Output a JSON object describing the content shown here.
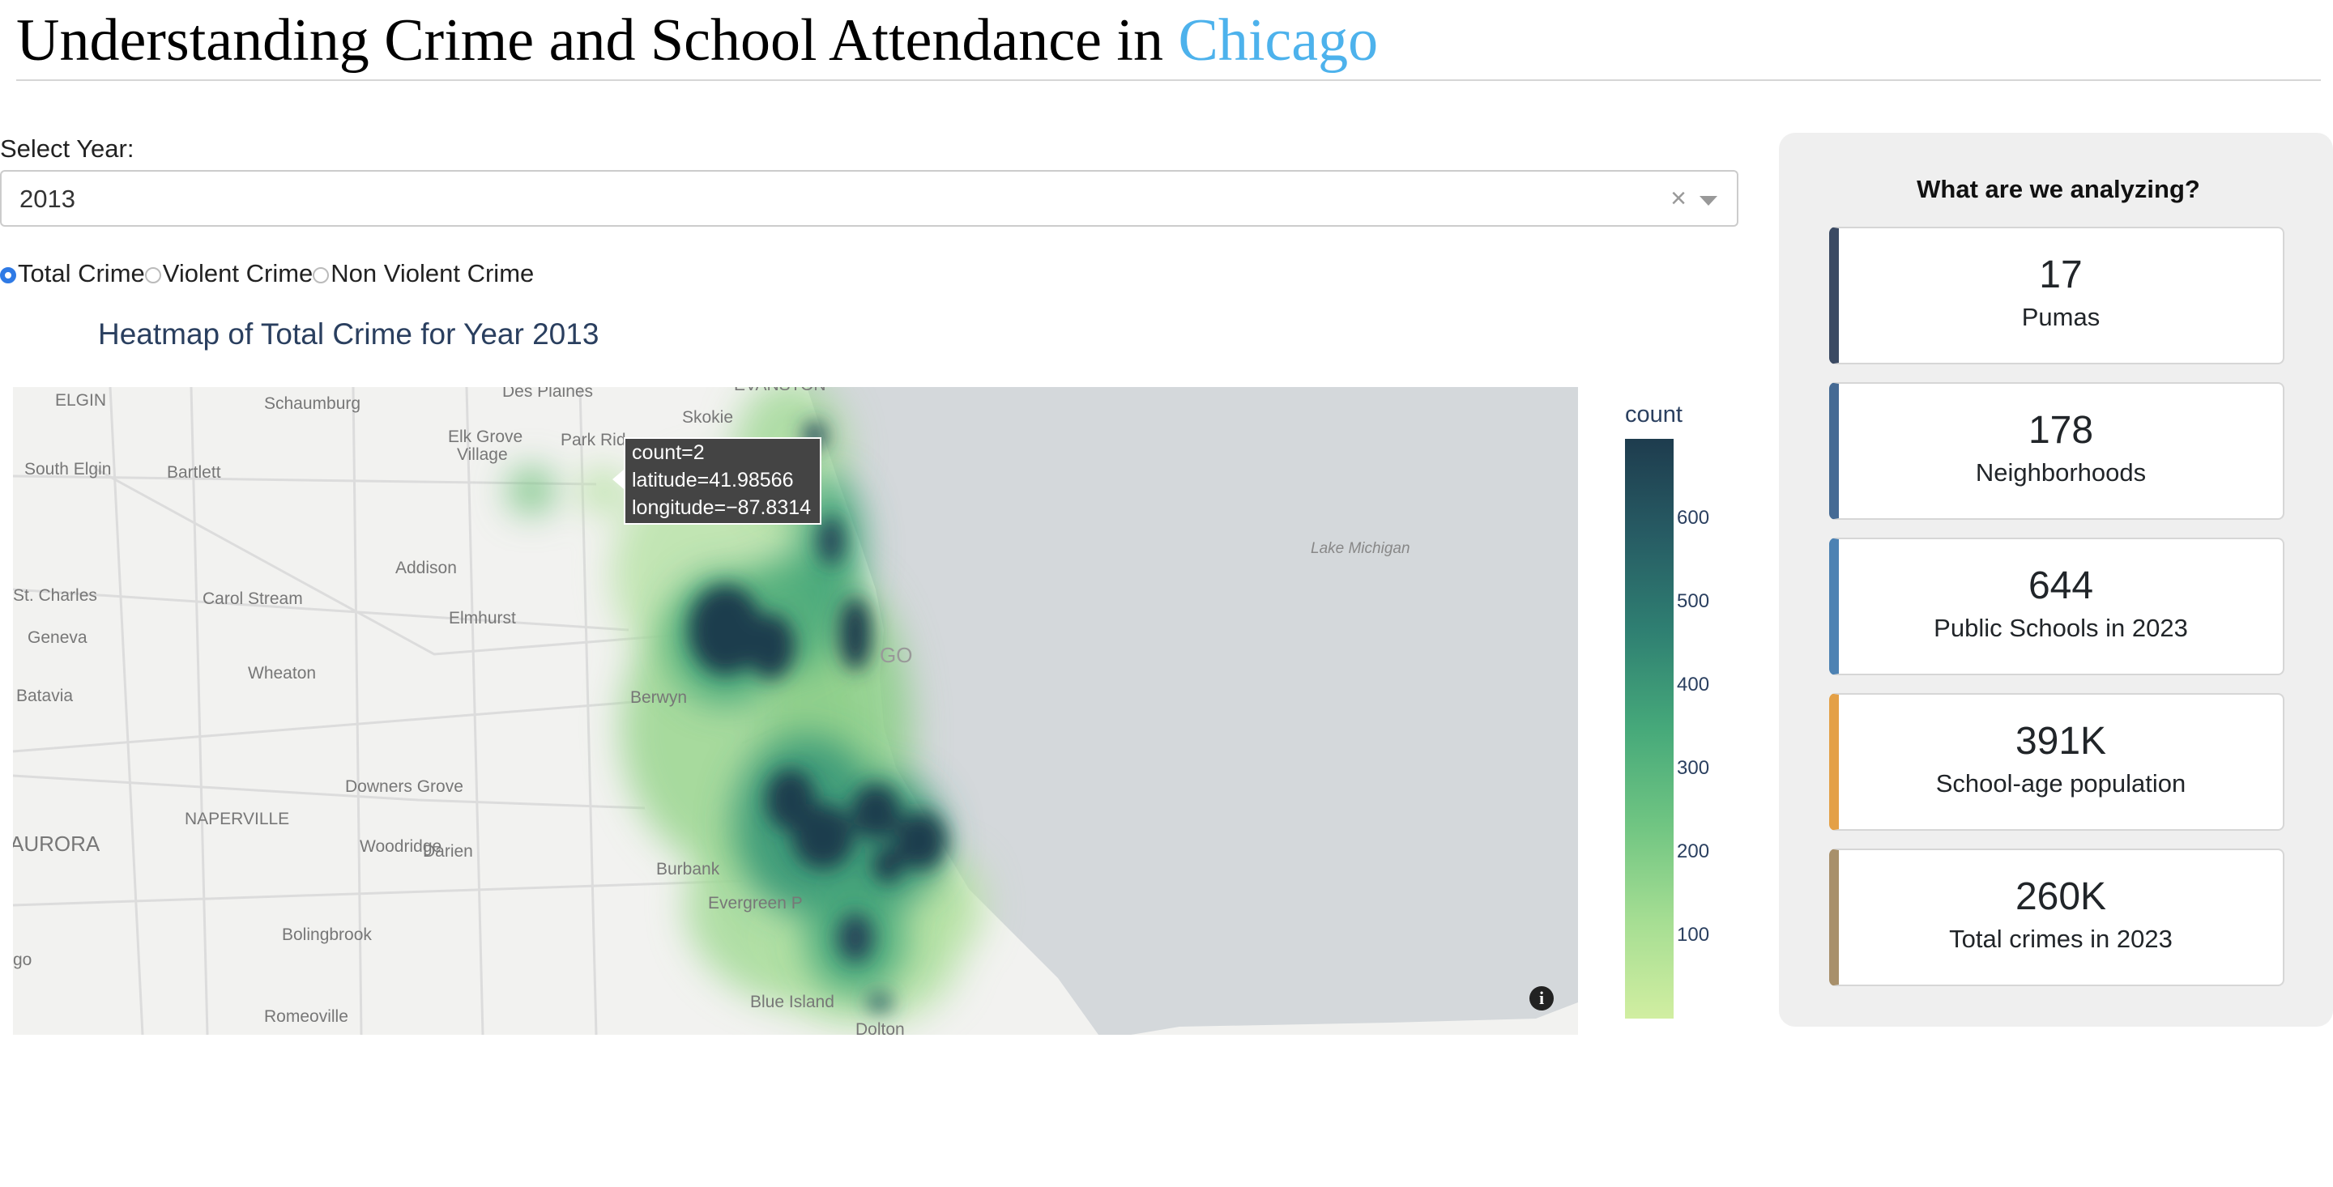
{
  "header": {
    "title_prefix": "Understanding Crime and School Attendance in ",
    "title_accent": "Chicago"
  },
  "year_select": {
    "label": "Select Year:",
    "value": "2013",
    "clear_symbol": "×"
  },
  "crime_type": {
    "options": [
      {
        "label": "Total Crime",
        "selected": true
      },
      {
        "label": "Violent Crime",
        "selected": false
      },
      {
        "label": "Non Violent Crime",
        "selected": false
      }
    ]
  },
  "chart": {
    "title": "Heatmap of Total Crime for Year 2013",
    "colorbar_title": "count",
    "colorbar_ticks": [
      "600",
      "500",
      "400",
      "300",
      "200",
      "100"
    ],
    "tooltip": {
      "count": "count=2",
      "latitude": "latitude=41.98566",
      "longitude": "longitude=−87.8314"
    },
    "info_symbol": "i",
    "map_labels": [
      "ELGIN",
      "Schaumburg",
      "Des Plaines",
      "Skokie",
      "EVANSTON",
      "Elk Grove Village",
      "Park Rid",
      "South Elgin",
      "Bartlett",
      "Addison",
      "St. Charles",
      "Carol Stream",
      "Elmhurst",
      "Geneva",
      "Wheaton",
      "Berwyn",
      "Batavia",
      "Downers Grove",
      "NAPERVILLE",
      "AURORA",
      "Woodridge",
      "Darien",
      "Burbank",
      "Evergreen P",
      "Bolingbrook",
      "Romeoville",
      "Blue Island",
      "Dolton",
      "Lake Michigan",
      "GO",
      "go"
    ]
  },
  "chart_data": {
    "type": "heatmap",
    "title": "Heatmap of Total Crime for Year 2013",
    "colorbar": {
      "title": "count",
      "range": [
        0,
        700
      ],
      "ticks": [
        100,
        200,
        300,
        400,
        500,
        600
      ]
    },
    "colorscale": [
      "#d1eea1",
      "#a6de93",
      "#70c582",
      "#46a97a",
      "#2f8072",
      "#275c64",
      "#1e3c4e"
    ],
    "hover_point": {
      "count": 2,
      "latitude": 41.98566,
      "longitude": -87.8314
    }
  },
  "panel": {
    "heading": "What are we analyzing?",
    "cards": [
      {
        "value": "17",
        "label": "Pumas",
        "color": "#3b4a63"
      },
      {
        "value": "178",
        "label": "Neighborhoods",
        "color": "#456a94"
      },
      {
        "value": "644",
        "label": "Public Schools in 2023",
        "color": "#4d82b3"
      },
      {
        "value": "391K",
        "label": "School-age population",
        "color": "#e4a046"
      },
      {
        "value": "260K",
        "label": "Total crimes in 2023",
        "color": "#a8906b"
      }
    ]
  }
}
